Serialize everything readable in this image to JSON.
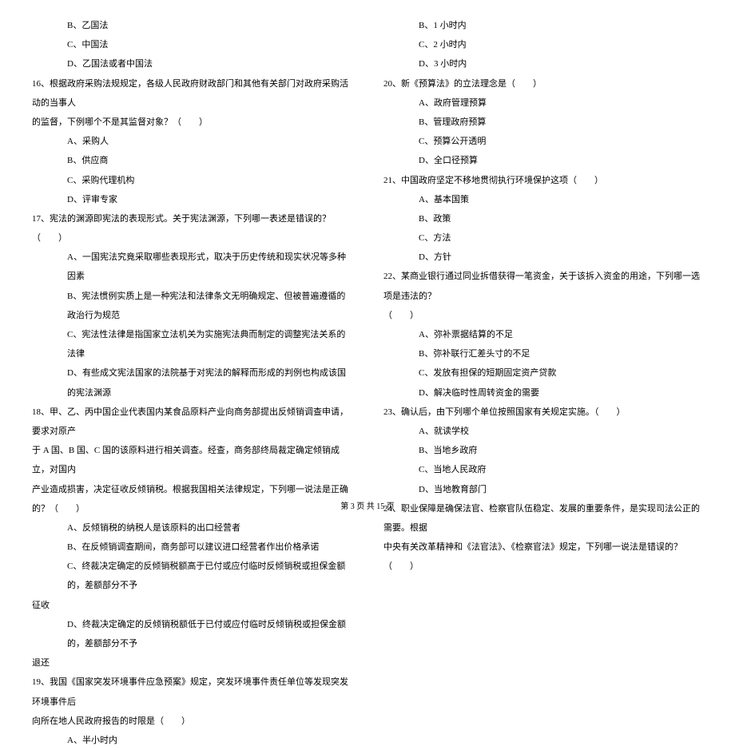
{
  "left": {
    "l01": "B、乙国法",
    "l02": "C、中国法",
    "l03": "D、乙国法或者中国法",
    "l04": "16、根据政府采购法规规定，各级人民政府财政部门和其他有关部门对政府采购活动的当事人",
    "l05": "的监督，下例哪个不是其监督对象？（　　）",
    "l06": "A、采购人",
    "l07": "B、供应商",
    "l08": "C、采购代理机构",
    "l09": "D、评审专家",
    "l10": "17、宪法的渊源即宪法的表现形式。关于宪法渊源，下列哪一表述是错误的？（　　）",
    "l11": "A、一国宪法究竟采取哪些表现形式，取决于历史传统和现实状况等多种因素",
    "l12": "B、宪法惯例实质上是一种宪法和法律条文无明确规定、但被普遍遵循的政治行为规范",
    "l13": "C、宪法性法律是指国家立法机关为实施宪法典而制定的调整宪法关系的法律",
    "l14": "D、有些成文宪法国家的法院基于对宪法的解释而形成的判例也构成该国的宪法渊源",
    "l15": "18、甲、乙、丙中国企业代表国内某食品原料产业向商务部提出反倾销调查申请，要求对原产",
    "l16": "于 A 国、B 国、C 国的该原料进行相关调查。经查，商务部终局裁定确定倾销成立，对国内",
    "l17": "产业造成损害，决定征收反倾销税。根据我国相关法律规定，下列哪一说法是正确的？（　　）",
    "l18": "A、反倾销税的纳税人是该原料的出口经营者",
    "l19": "B、在反倾销调查期间，商务部可以建议进口经营者作出价格承诺",
    "l20": "C、终裁决定确定的反倾销税额高于已付或应付临时反倾销税或担保金额的，差额部分不予",
    "l21": "征收",
    "l22": "D、终裁决定确定的反倾销税额低于已付或应付临时反倾销税或担保金额的，差额部分不予",
    "l23": "退还",
    "l24": "19、我国《国家突发环境事件应急预案》规定，突发环境事件责任单位等发现突发环境事件后",
    "l25": "向所在地人民政府报告的时限是（　　）",
    "l26": "A、半小时内"
  },
  "right": {
    "r01": "B、1 小时内",
    "r02": "C、2 小时内",
    "r03": "D、3 小时内",
    "r04": "20、新《预算法》的立法理念是（　　）",
    "r05": "A、政府管理预算",
    "r06": "B、管理政府预算",
    "r07": "C、预算公开透明",
    "r08": "D、全口径预算",
    "r09": "21、中国政府坚定不移地贯彻执行环境保护这项（　　）",
    "r10": "A、基本国策",
    "r11": "B、政策",
    "r12": "C、方法",
    "r13": "D、方针",
    "r14": "22、某商业银行通过同业拆借获得一笔资金，关于该拆入资金的用途，下列哪一选项是违法的？",
    "r15": "（　　）",
    "r16": "A、弥补票据结算的不足",
    "r17": "B、弥补联行汇差头寸的不足",
    "r18": "C、发放有担保的短期固定资产贷款",
    "r19": "D、解决临时性周转资金的需要",
    "r20": "23、确认后，由下列哪个单位按照国家有关规定实施。（　　）",
    "r21": "A、就读学校",
    "r22": "B、当地乡政府",
    "r23": "C、当地人民政府",
    "r24": "D、当地教育部门",
    "r25": "24、职业保障是确保法官、检察官队伍稳定、发展的重要条件，是实现司法公正的需要。根据",
    "r26": "中央有关改革精神和《法官法》、《检察官法》规定，下列哪一说法是错误的？（　　）"
  },
  "footer": "第 3 页 共 15 页"
}
